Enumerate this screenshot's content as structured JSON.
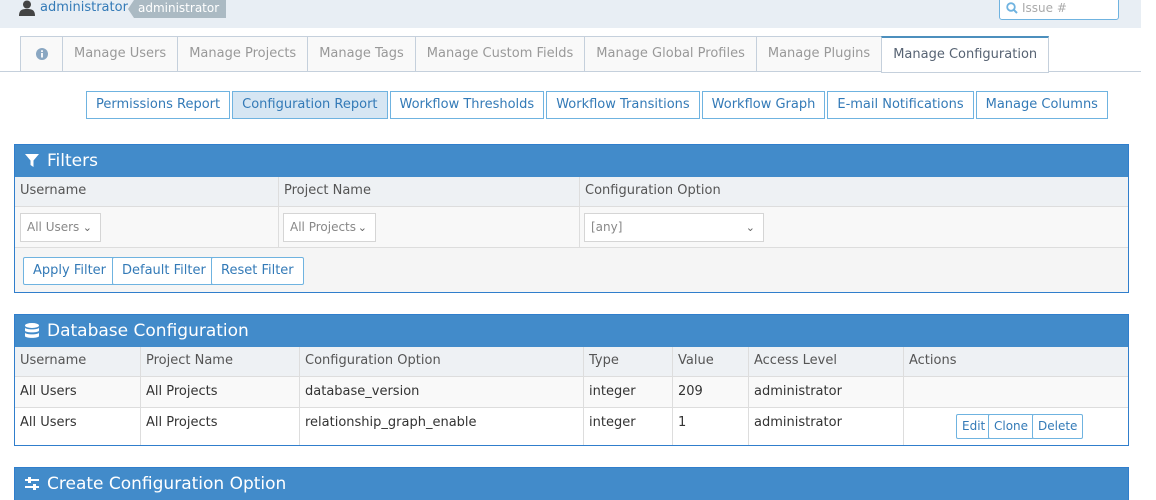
{
  "header": {
    "username": "administrator",
    "role": "administrator",
    "search": {
      "placeholder": "Issue #"
    }
  },
  "tabs": [
    {
      "label": "",
      "icon": "info-icon"
    },
    {
      "label": "Manage Users"
    },
    {
      "label": "Manage Projects"
    },
    {
      "label": "Manage Tags"
    },
    {
      "label": "Manage Custom Fields"
    },
    {
      "label": "Manage Global Profiles"
    },
    {
      "label": "Manage Plugins"
    },
    {
      "label": "Manage Configuration",
      "active": true
    }
  ],
  "subnav": [
    {
      "label": "Permissions Report"
    },
    {
      "label": "Configuration Report",
      "active": true
    },
    {
      "label": "Workflow Thresholds"
    },
    {
      "label": "Workflow Transitions"
    },
    {
      "label": "Workflow Graph"
    },
    {
      "label": "E-mail Notifications"
    },
    {
      "label": "Manage Columns"
    }
  ],
  "filters": {
    "title": "Filters",
    "columns": [
      "Username",
      "Project Name",
      "Configuration Option"
    ],
    "username_value": "All Users",
    "project_value": "All Projects",
    "option_value": "[any]",
    "buttons": {
      "apply": "Apply Filter",
      "default": "Default Filter",
      "reset": "Reset Filter"
    }
  },
  "database": {
    "title": "Database Configuration",
    "columns": [
      "Username",
      "Project Name",
      "Configuration Option",
      "Type",
      "Value",
      "Access Level",
      "Actions"
    ],
    "rows": [
      {
        "username": "All Users",
        "project": "All Projects",
        "option": "database_version",
        "type": "integer",
        "value": "209",
        "access": "administrator",
        "actions": false
      },
      {
        "username": "All Users",
        "project": "All Projects",
        "option": "relationship_graph_enable",
        "type": "integer",
        "value": "1",
        "access": "administrator",
        "actions": true
      }
    ],
    "actions": {
      "edit": "Edit",
      "clone": "Clone",
      "delete": "Delete"
    }
  },
  "create": {
    "title": "Create Configuration Option"
  },
  "colors": {
    "accent": "#428bca",
    "link": "#337ab7",
    "border": "#6fb3e0"
  }
}
